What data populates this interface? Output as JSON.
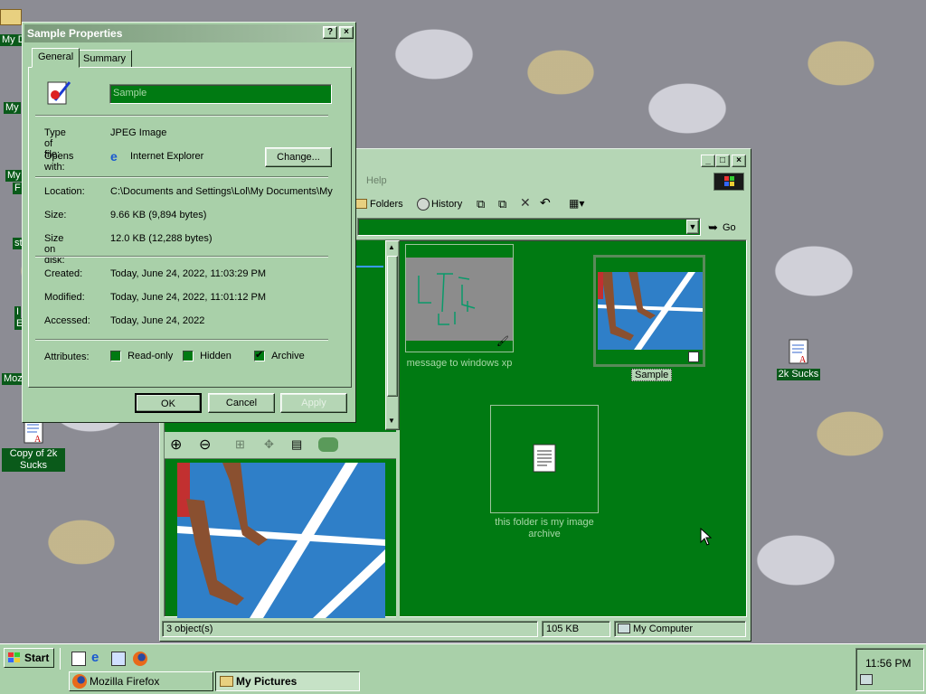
{
  "desktop": {
    "icons": [
      {
        "label": "Copy of 2k Sucks"
      },
      {
        "label": "2k Sucks"
      }
    ],
    "partial_labels": [
      "My D",
      "My",
      "My",
      "F",
      "st",
      "I",
      "E",
      "Moz"
    ]
  },
  "explorer": {
    "menu": {
      "help": "Help"
    },
    "toolbar": {
      "folders": "Folders",
      "history": "History"
    },
    "address": {
      "go": "Go"
    },
    "items": [
      {
        "label": "message to windows xp"
      },
      {
        "label": "Sample"
      },
      {
        "label": "this folder is my image archive"
      }
    ],
    "status": {
      "objects": "3 object(s)",
      "size": "105 KB",
      "zone": "My Computer"
    }
  },
  "dialog": {
    "title": "Sample Properties",
    "help_btn": "?",
    "close_btn": "×",
    "tabs": [
      "General",
      "Summary"
    ],
    "name": "Sample",
    "type_label": "Type of file:",
    "type_value": "JPEG Image",
    "opens_label": "Opens with:",
    "opens_value": "Internet Explorer",
    "change_btn": "Change...",
    "location_label": "Location:",
    "location_value": "C:\\Documents and Settings\\Lol\\My Documents\\My",
    "size_label": "Size:",
    "size_value": "9.66 KB (9,894 bytes)",
    "sizeondisk_label": "Size on disk:",
    "sizeondisk_value": "12.0 KB (12,288 bytes)",
    "created_label": "Created:",
    "created_value": "Today, June 24, 2022, 11:03:29 PM",
    "modified_label": "Modified:",
    "modified_value": "Today, June 24, 2022, 11:01:12 PM",
    "accessed_label": "Accessed:",
    "accessed_value": "Today, June 24, 2022",
    "attributes_label": "Attributes:",
    "readonly": "Read-only",
    "hidden": "Hidden",
    "archive": "Archive",
    "ok": "OK",
    "cancel": "Cancel",
    "apply": "Apply"
  },
  "taskbar": {
    "start": "Start",
    "tasks": [
      "Mozilla Firefox",
      "My Pictures"
    ],
    "clock": "11:56 PM"
  }
}
